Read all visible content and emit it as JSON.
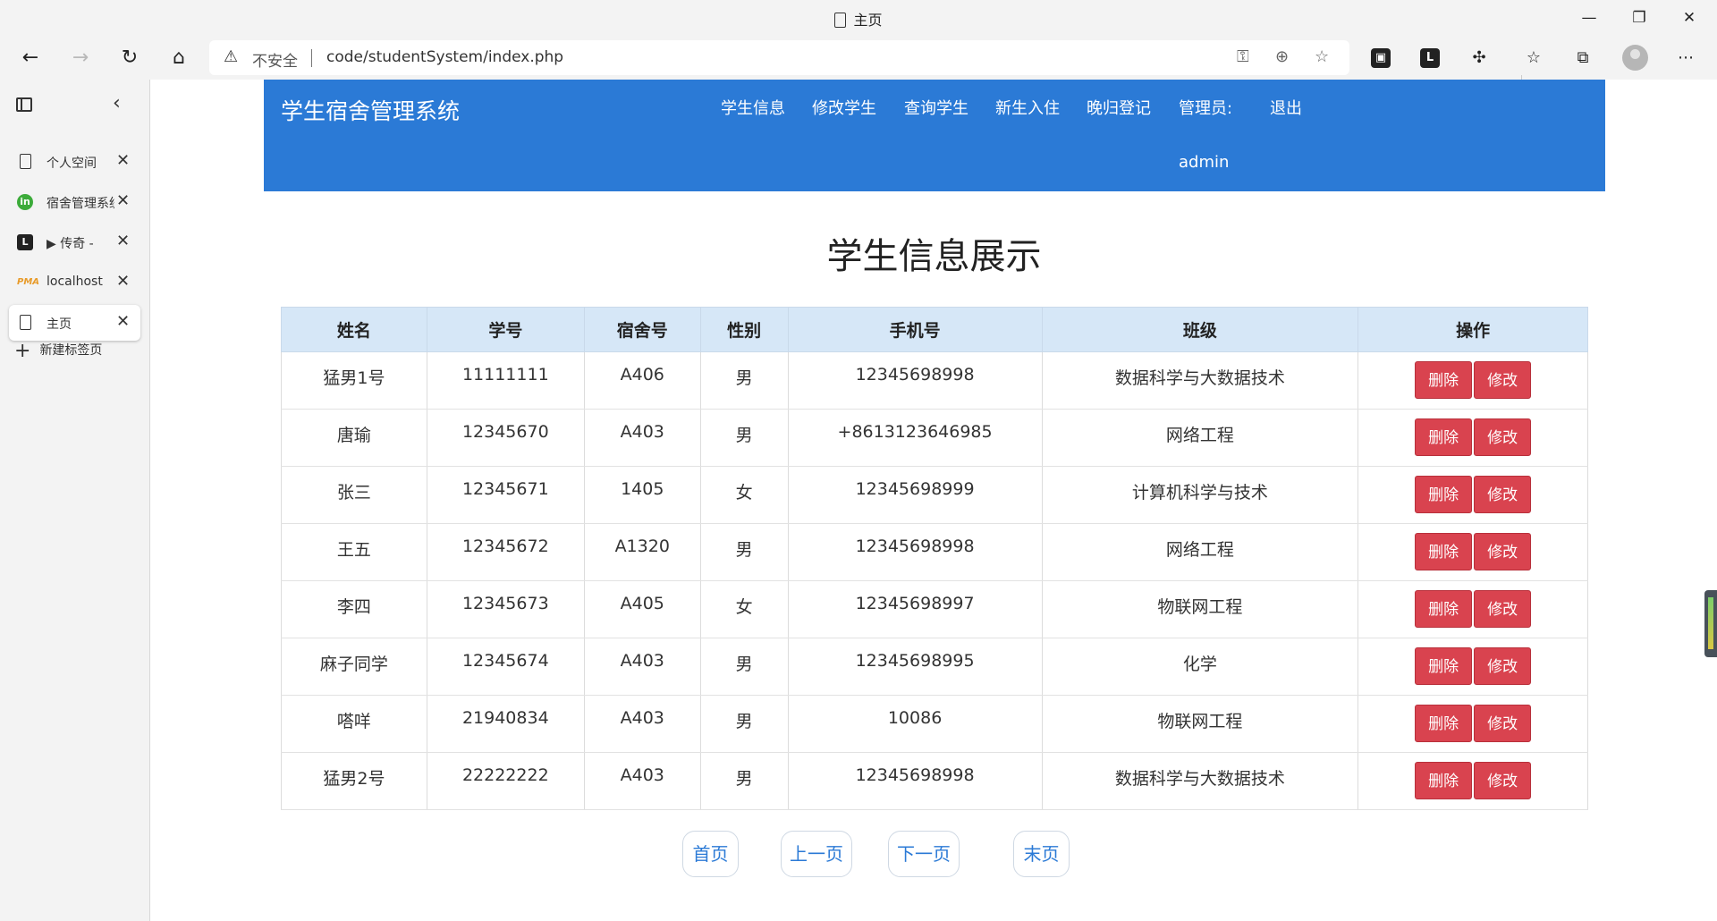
{
  "window": {
    "title": "主页",
    "minimize": "—",
    "restore": "❐",
    "close": "✕"
  },
  "toolbar": {
    "back": "←",
    "forward": "→",
    "reload": "↻",
    "home": "⌂",
    "warning_icon": "⚠",
    "security_label": "不安全",
    "url": "code/studentSystem/index.php",
    "icons": [
      "key-icon",
      "zoom-icon",
      "add-favorite-icon",
      "extension-tab-icon",
      "leetcode-icon",
      "puzzle-icon",
      "favorites-icon",
      "collections-icon",
      "profile-avatar",
      "more-icon"
    ]
  },
  "sidebar": {
    "tabs": [
      {
        "label": "个人空间",
        "icon": "doc",
        "glyph": ""
      },
      {
        "label": "宿舍管理系统",
        "icon": "green",
        "glyph": "in"
      },
      {
        "label": "▶ 传奇 - ",
        "icon": "dark",
        "glyph": "L"
      },
      {
        "label": "localhost",
        "icon": "pma",
        "glyph": "PMA"
      },
      {
        "label": "主页",
        "icon": "doc",
        "glyph": ""
      }
    ],
    "new_tab": "新建标签页"
  },
  "navbar": {
    "brand": "学生宿舍管理系统",
    "items": [
      "学生信息",
      "修改学生",
      "查询学生",
      "新生入住",
      "晚归登记",
      "管理员:",
      "退出"
    ],
    "admin": "admin"
  },
  "page_title": "学生信息展示",
  "table": {
    "headers": [
      "姓名",
      "学号",
      "宿舍号",
      "性别",
      "手机号",
      "班级",
      "操作"
    ],
    "rows": [
      [
        "猛男1号",
        "11111111",
        "A406",
        "男",
        "12345698998",
        "数据科学与大数据技术"
      ],
      [
        "唐瑜",
        "12345670",
        "A403",
        "男",
        "+8613123646985",
        "网络工程"
      ],
      [
        "张三",
        "12345671",
        "1405",
        "女",
        "12345698999",
        "计算机科学与技术"
      ],
      [
        "王五",
        "12345672",
        "A1320",
        "男",
        "12345698998",
        "网络工程"
      ],
      [
        "李四",
        "12345673",
        "A405",
        "女",
        "12345698997",
        "物联网工程"
      ],
      [
        "麻子同学",
        "12345674",
        "A403",
        "男",
        "12345698995",
        "化学"
      ],
      [
        "嗒咩",
        "21940834",
        "A403",
        "男",
        "10086",
        "物联网工程"
      ],
      [
        "猛男2号",
        "22222222",
        "A403",
        "男",
        "12345698998",
        "数据科学与大数据技术"
      ]
    ],
    "delete_label": "删除",
    "edit_label": "修改"
  },
  "pager": {
    "first": "首页",
    "prev": "上一页",
    "next": "下一页",
    "last": "末页"
  },
  "colors": {
    "navbar": "#2b7ad6",
    "header_row": "#d6e7f7",
    "danger_button": "#d9434f"
  }
}
